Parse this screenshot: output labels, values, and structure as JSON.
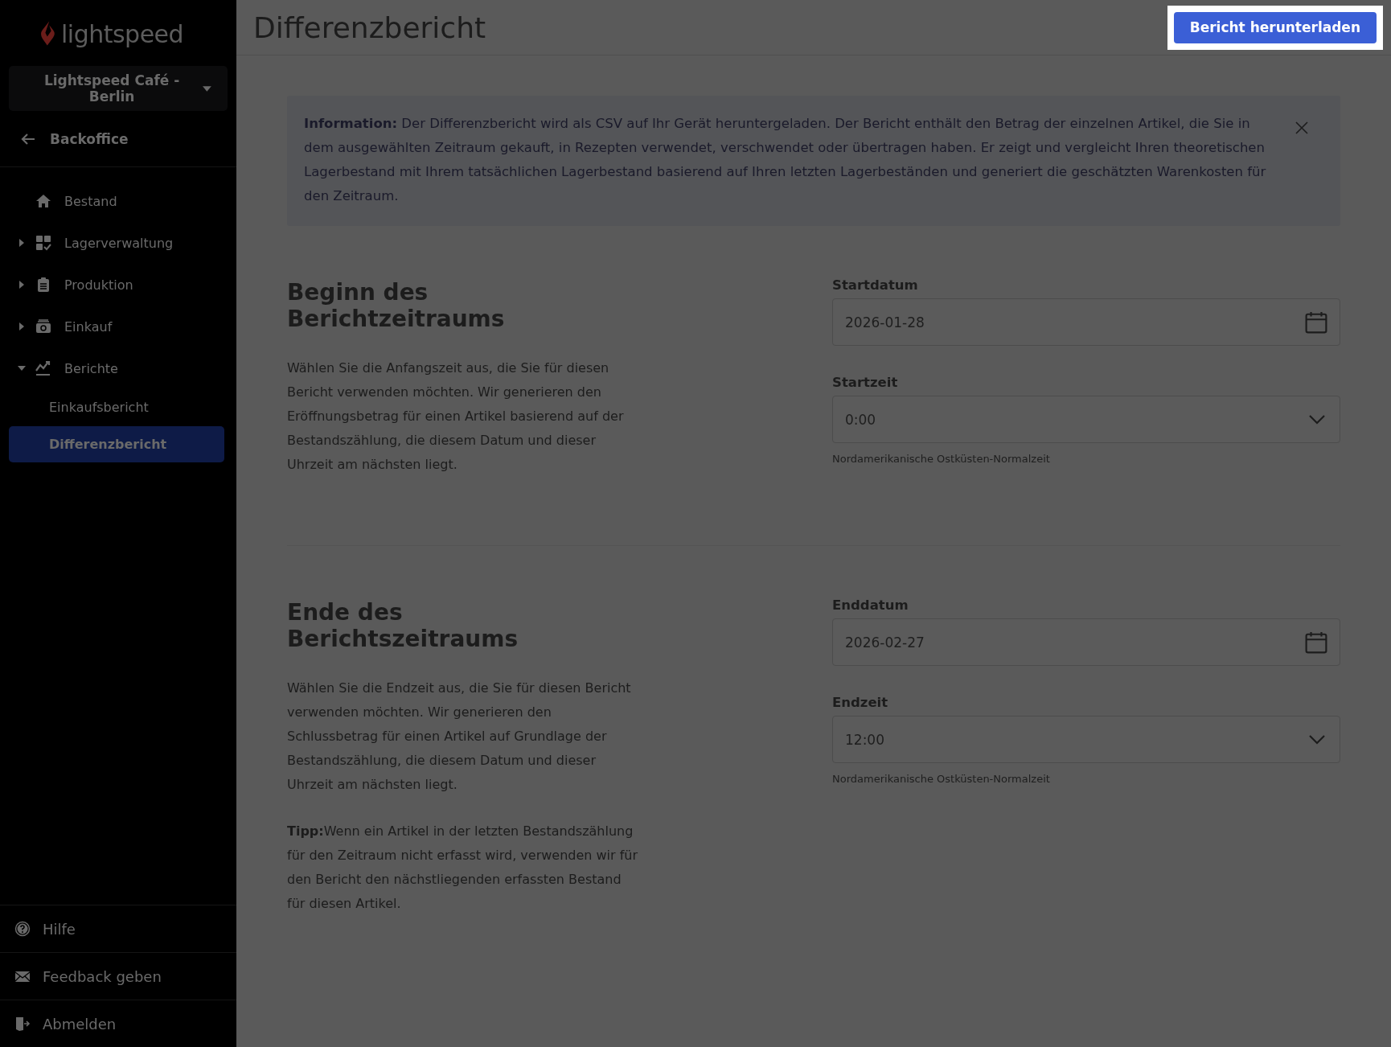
{
  "sidebar": {
    "logo": "lightspeed",
    "store": "Lightspeed Café - Berlin",
    "back": "Backoffice",
    "nav": [
      {
        "label": "Bestand"
      },
      {
        "label": "Lagerverwaltung",
        "expanded": false
      },
      {
        "label": "Produktion",
        "expanded": false
      },
      {
        "label": "Einkauf",
        "expanded": false
      },
      {
        "label": "Berichte",
        "expanded": true,
        "children": [
          {
            "label": "Einkaufsbericht",
            "selected": false
          },
          {
            "label": "Differenzbericht",
            "selected": true
          }
        ]
      }
    ],
    "footer": [
      {
        "label": "Hilfe"
      },
      {
        "label": "Feedback geben"
      },
      {
        "label": "Abmelden"
      }
    ]
  },
  "header": {
    "title": "Differenzbericht",
    "button": "Bericht herunterladen"
  },
  "info": {
    "text": "**Information:** Der Differenzbericht wird als CSV auf Ihr Gerät heruntergeladen. Der Bericht enthält den Betrag der einzelnen Artikel, die Sie in dem ausgewählten Zeitraum gekauft, in Rezepten verwendet, verschwendet oder übertragen haben. Er zeigt und vergleicht Ihren theoretischen Lagerbestand mit Ihrem tatsächlichen Lagerbestand basierend auf Ihren letzten Lagerbeständen und generiert die geschätzten Warenkosten für den Zeitraum."
  },
  "sections": [
    {
      "heading": "Beginn des Berichtzeitraums",
      "paragraphs": [
        "Wählen Sie die Anfangszeit aus, die Sie für diesen Bericht verwenden möchten. Wir generieren den Eröffnungsbetrag für einen Artikel basierend auf der Bestandszählung, die diesem Datum und dieser Uhrzeit am nächsten liegt."
      ],
      "fields": [
        {
          "label": "Startdatum",
          "kind": "date",
          "value": "2026-01-28"
        },
        {
          "label": "Startzeit",
          "kind": "select",
          "value": "0:00",
          "hint": "Nordamerikanische Ostküsten-Normalzeit"
        }
      ]
    },
    {
      "heading": "Ende des Berichtszeitraums",
      "paragraphs": [
        "Wählen Sie die Endzeit aus, die Sie für diesen Bericht verwenden möchten. Wir generieren den Schlussbetrag für einen Artikel auf Grundlage der Bestandszählung, die diesem Datum und dieser Uhrzeit am nächsten liegt.",
        "**Tipp:**Wenn ein Artikel in der letzten Bestandszählung für den Zeitraum nicht erfasst wird, verwenden wir für den Bericht den nächstliegenden erfassten Bestand für diesen Artikel."
      ],
      "fields": [
        {
          "label": "Enddatum",
          "kind": "date",
          "value": "2026-02-27"
        },
        {
          "label": "Endzeit",
          "kind": "select",
          "value": "12:00",
          "hint": "Nordamerikanische Ostküsten-Normalzeit"
        }
      ]
    }
  ]
}
